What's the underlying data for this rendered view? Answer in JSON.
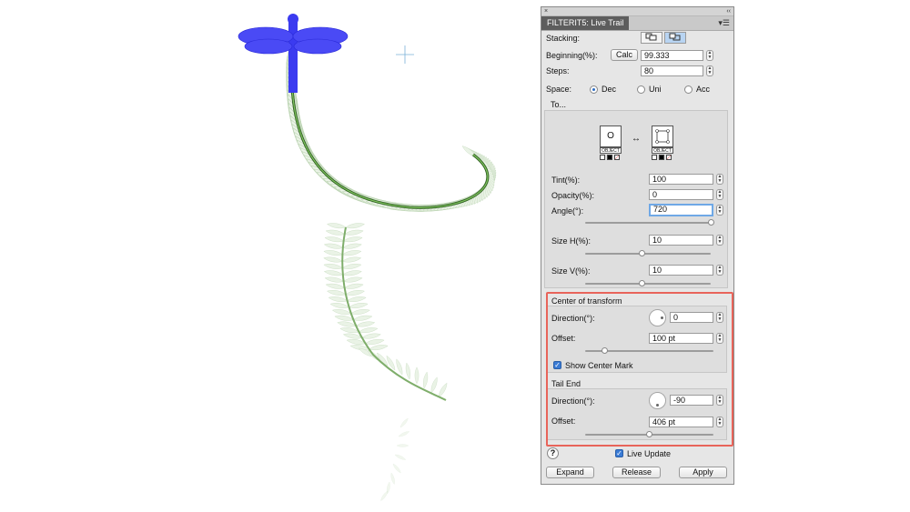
{
  "panel": {
    "close_glyph": "×",
    "collapse_glyph": "‹‹",
    "tab_title": "FILTERIT5: Live Trail",
    "menu_glyph": "▾☰"
  },
  "stacking": {
    "label": "Stacking:",
    "icon_a": "stack-front-icon",
    "icon_b": "stack-back-icon"
  },
  "beginning": {
    "label": "Beginning(%):",
    "calc_label": "Calc",
    "value": "99.333"
  },
  "steps": {
    "label": "Steps:",
    "value": "80"
  },
  "space": {
    "label": "Space:",
    "options": [
      {
        "label": "Dec",
        "selected": true
      },
      {
        "label": "Uni",
        "selected": false
      },
      {
        "label": "Acc",
        "selected": false
      }
    ]
  },
  "to": {
    "title": "To...",
    "from_object": {
      "symbol": "O",
      "caption": "OBJECT"
    },
    "to_object": {
      "caption": "OBJECT"
    },
    "swap_glyph": "↔",
    "tint": {
      "label": "Tint(%):",
      "value": "100"
    },
    "opacity": {
      "label": "Opacity(%):",
      "value": "0"
    },
    "angle": {
      "label": "Angle(°):",
      "value": "720",
      "slider": 1.0
    },
    "size_h": {
      "label": "Size H(%):",
      "value": "10",
      "slider": 0.45
    },
    "size_v": {
      "label": "Size V(%):",
      "value": "10",
      "slider": 0.45
    }
  },
  "center": {
    "title": "Center of transform",
    "direction": {
      "label": "Direction(°):",
      "value": "0"
    },
    "offset": {
      "label": "Offset:",
      "value": "100 pt",
      "slider": 0.15
    },
    "show_mark": {
      "label": "Show Center Mark",
      "checked": true
    }
  },
  "tail": {
    "title": "Tail End",
    "direction": {
      "label": "Direction(°):",
      "value": "-90"
    },
    "offset": {
      "label": "Offset:",
      "value": "406 pt",
      "slider": 0.5
    }
  },
  "footer": {
    "help_glyph": "?",
    "live_update": {
      "label": "Live Update",
      "checked": true
    },
    "expand_label": "Expand",
    "release_label": "Release",
    "apply_label": "Apply"
  },
  "colors": {
    "highlight": "#e8645a",
    "accent": "#3a7bd5",
    "art_blue": "#3b3bf0",
    "art_green": "#4f8f3a"
  },
  "check_glyph": "✓"
}
